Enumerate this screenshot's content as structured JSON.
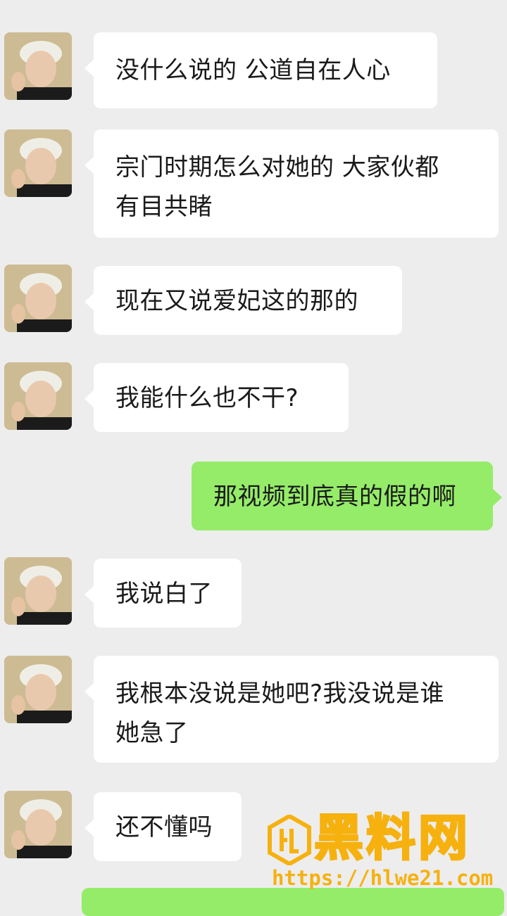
{
  "messages": [
    {
      "side": "left",
      "text": "没什么说的 公道自在人心"
    },
    {
      "side": "left",
      "lines": [
        "宗门时期怎么对她的 大家伙都",
        "有目共睹"
      ]
    },
    {
      "side": "left",
      "text": "现在又说爱妃这的那的"
    },
    {
      "side": "left",
      "text": "我能什么也不干?"
    },
    {
      "side": "right",
      "text": "那视频到底真的假的啊"
    },
    {
      "side": "left",
      "text": "我说白了"
    },
    {
      "side": "left",
      "lines": [
        "我根本没说是她吧?我没说是谁",
        "她急了"
      ]
    },
    {
      "side": "left",
      "text": "还不懂吗"
    }
  ],
  "watermark": {
    "brand": "黑料网",
    "url": "https://hlwe21.com"
  },
  "colors": {
    "background": "#ededed",
    "incoming_bubble": "#ffffff",
    "outgoing_bubble": "#95ec69",
    "watermark": "#f6b10f"
  }
}
